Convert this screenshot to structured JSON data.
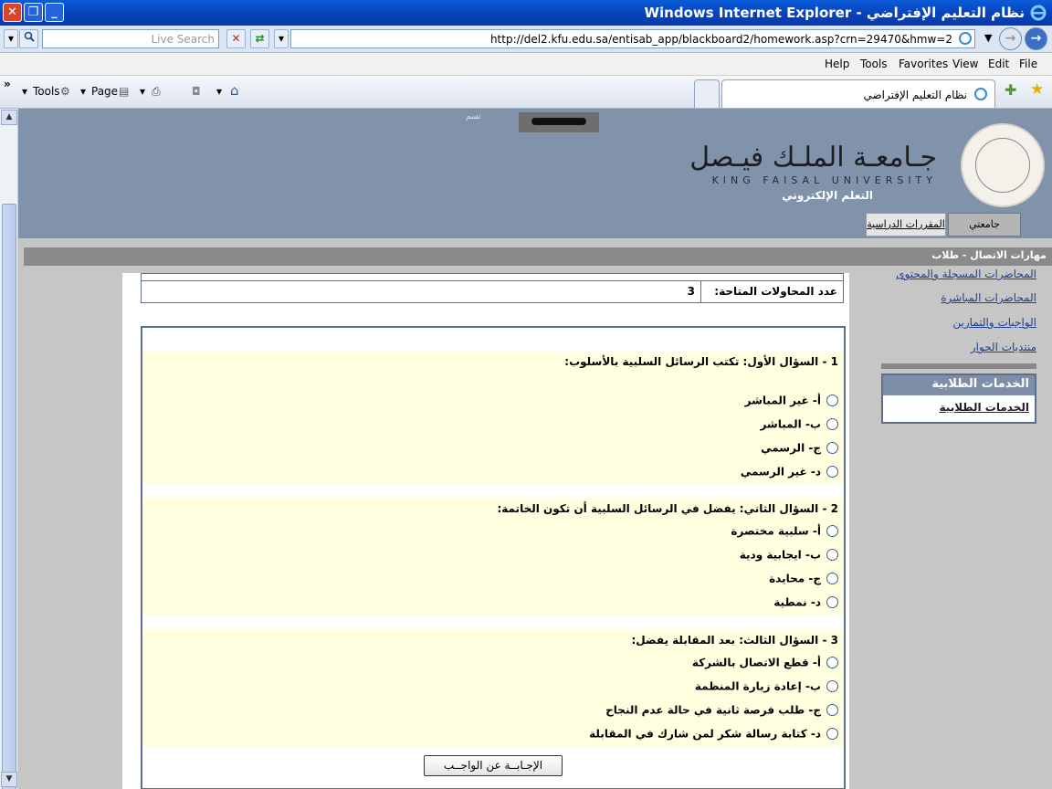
{
  "window": {
    "title": "نظام التعليم الإفتراضي - Windows Internet Explorer",
    "close": "✕",
    "restore": "❐",
    "minimize": "_"
  },
  "addressbar": {
    "search_placeholder": "Live Search",
    "url": "http://del2.kfu.edu.sa/entisab_app/blackboard2/homework.asp?crn=29470&hmw=2"
  },
  "menu": {
    "items": [
      "Help",
      "Tools",
      "Favorites",
      "View",
      "Edit",
      "File"
    ]
  },
  "commandbar": {
    "chevrons": "»",
    "tools_label": "Tools",
    "page_label": "Page",
    "tab_title": "نظام التعليم الإفتراضي"
  },
  "header": {
    "user_label": "تسم",
    "uni_name_ar": "جـامعـة الملـك فيـصل",
    "uni_name_en": "KING FAISAL UNIVERSITY",
    "elearning": "التعلم الإلكتروني",
    "tabs": [
      "جامعتي",
      "المقررات الدراسية"
    ]
  },
  "breadcrumb": "مهارات الاتصال - طلاب",
  "info": {
    "attempts_label": "عدد المحاولات المتاحة:",
    "attempts_value": "3"
  },
  "quiz": {
    "questions": [
      {
        "text": "1 - السؤال الأول: تكتب الرسائل السلبية بالأسلوب:",
        "options": [
          "أ- غير المباشر",
          "ب- المباشر",
          "ج- الرسمي",
          "د- غير الرسمي"
        ]
      },
      {
        "text": "2 - السؤال الثاني: يفضل في الرسائل السلبية أن تكون الخاتمة:",
        "options": [
          "أ- سلبية مختصرة",
          "ب- ايجابية ودية",
          "ج- محايدة",
          "د- نمطية"
        ]
      },
      {
        "text": "3 - السؤال الثالث: بعد المقابلة يفضل:",
        "options": [
          "أ- قطع الاتصال بالشركة",
          "ب- إعادة زيارة المنظمة",
          "ج- طلب فرصة ثانية في حالة عدم النجاح",
          "د- كتابة رسالة شكر لمن شارك في المقابلة"
        ]
      }
    ],
    "submit_label": "الإجـابــة عن الواجــب"
  },
  "sidebar": {
    "links": [
      "المحاضرات المسجلة والمحتوى",
      "المحاضرات المباشرة",
      "الواجبات والتمارين",
      "منتديات الحوار"
    ],
    "services_title": "الخدمات الطلابية",
    "services_link": "الخدمات الطلابية"
  }
}
